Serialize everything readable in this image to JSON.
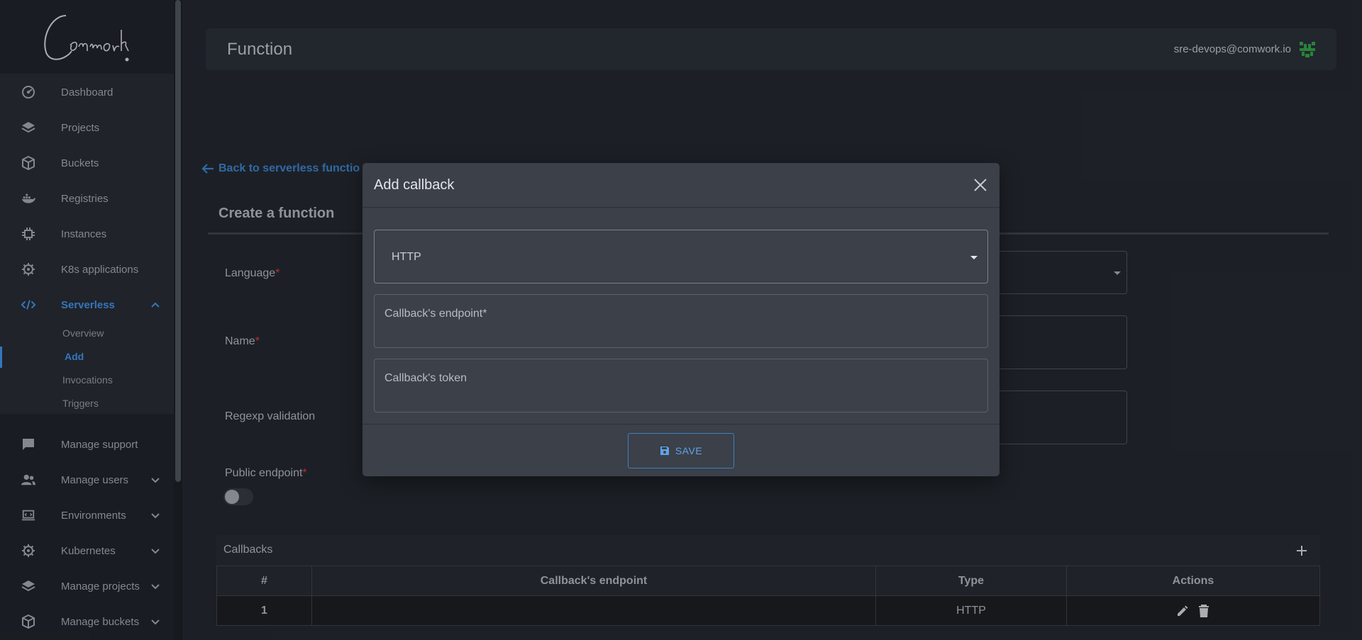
{
  "sidebar": {
    "logo_text": "Comwork",
    "items": [
      {
        "label": "Dashboard",
        "icon": "dashboard-icon"
      },
      {
        "label": "Projects",
        "icon": "layers-icon"
      },
      {
        "label": "Buckets",
        "icon": "box-icon"
      },
      {
        "label": "Registries",
        "icon": "docker-icon"
      },
      {
        "label": "Instances",
        "icon": "chip-icon"
      },
      {
        "label": "K8s applications",
        "icon": "helm-icon"
      },
      {
        "label": "Serverless",
        "icon": "code-icon"
      },
      {
        "label": "Manage support",
        "icon": "chat-icon"
      },
      {
        "label": "Manage users",
        "icon": "users-icon"
      },
      {
        "label": "Environments",
        "icon": "laptop-icon"
      },
      {
        "label": "Kubernetes",
        "icon": "helm-icon"
      },
      {
        "label": "Manage projects",
        "icon": "layers-icon"
      },
      {
        "label": "Manage buckets",
        "icon": "box-icon"
      }
    ],
    "serverless_sub": [
      "Overview",
      "Add",
      "Invocations",
      "Triggers"
    ],
    "accent": "#3d8be0"
  },
  "header": {
    "title": "Function",
    "user_email": "sre-devops@comwork.io"
  },
  "page": {
    "back_link": "Back to serverless functio",
    "heading": "Create a function",
    "fields": {
      "language": "Language",
      "name": "Name",
      "regexp": "Regexp validation",
      "public_endpoint": "Public endpoint",
      "required_mark": "*"
    },
    "callbacks": {
      "title": "Callbacks",
      "columns": [
        "#",
        "Callback's endpoint",
        "Type",
        "Actions"
      ],
      "rows": [
        {
          "num": "1",
          "endpoint": "",
          "type": "HTTP"
        }
      ]
    }
  },
  "modal": {
    "title": "Add callback",
    "type_value": "HTTP",
    "endpoint_placeholder": "Callback's endpoint*",
    "token_placeholder": "Callback's token",
    "save_label": "SAVE"
  }
}
